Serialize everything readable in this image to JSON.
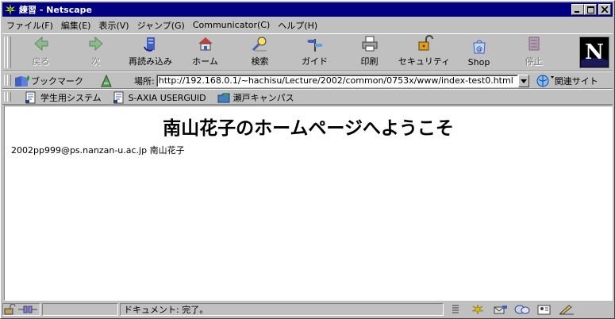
{
  "window": {
    "title": "練習 - Netscape",
    "controls": [
      "minimize",
      "maximize",
      "close"
    ]
  },
  "menubar": {
    "items": [
      {
        "label": "ファイル(F)"
      },
      {
        "label": "編集(E)"
      },
      {
        "label": "表示(V)"
      },
      {
        "label": "ジャンプ(G)"
      },
      {
        "label": "Communicator(C)"
      },
      {
        "label": "ヘルプ(H)"
      }
    ]
  },
  "nav_toolbar": {
    "buttons": [
      {
        "label": "戻る",
        "icon": "back-arrow-icon",
        "enabled": false
      },
      {
        "label": "次",
        "icon": "forward-arrow-icon",
        "enabled": false
      },
      {
        "label": "再読み込み",
        "icon": "reload-icon",
        "enabled": true
      },
      {
        "label": "ホーム",
        "icon": "home-icon",
        "enabled": true
      },
      {
        "label": "検索",
        "icon": "search-icon",
        "enabled": true
      },
      {
        "label": "ガイド",
        "icon": "guide-icon",
        "enabled": true
      },
      {
        "label": "印刷",
        "icon": "print-icon",
        "enabled": true
      },
      {
        "label": "セキュリティ",
        "icon": "security-lock-icon",
        "enabled": true
      },
      {
        "label": "Shop",
        "icon": "shop-icon",
        "enabled": true
      },
      {
        "label": "停止",
        "icon": "stop-icon",
        "enabled": false
      }
    ],
    "logo_letter": "N"
  },
  "location_toolbar": {
    "bookmarks_label": "ブックマーク",
    "location_label": "場所:",
    "url": "http://192.168.0.1/~hachisu/Lecture/2002/common/0753x/www/index-test0.html",
    "related_label": "関連サイト"
  },
  "personal_toolbar": {
    "items": [
      {
        "label": "学生用システム"
      },
      {
        "label": "S-AXIA USERGUID"
      },
      {
        "label": "瀬戸キャンパス"
      }
    ]
  },
  "page": {
    "heading": "南山花子のホームページへようこそ",
    "text": "2002pp999@ps.nanzan-u.ac.jp 南山花子"
  },
  "statusbar": {
    "text": "ドキュメント: 完了。"
  },
  "colors": {
    "titlebar": "#000080",
    "chrome": "#c0c0c0",
    "content_bg": "#ffffff"
  }
}
